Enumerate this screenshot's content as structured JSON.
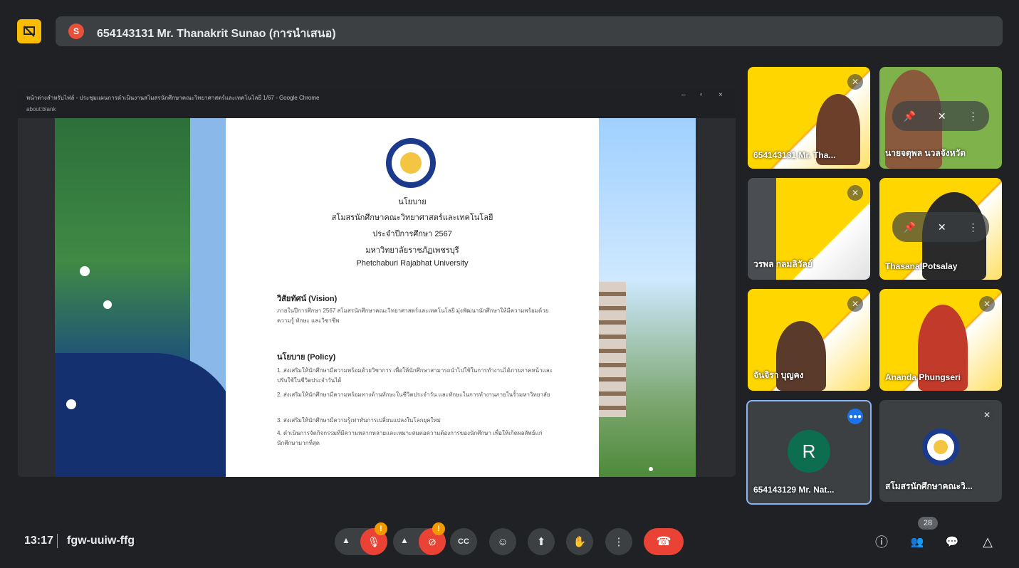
{
  "meeting": {
    "presenter_initial": "S",
    "presenter_label": "654143131 Mr. Thanakrit Sunao (การนำเสนอ)",
    "time": "13:17",
    "code": "fgw-uuiw-ffg",
    "participant_count": "28"
  },
  "shared_window": {
    "title": "หน้าต่างสำหรับไฟล์ - ประชุมแผนการดำเนินงานสโมสรนักศึกษาคณะวิทยาศาสตร์และเทคโนโลยี 1/67 - Google Chrome",
    "url": "about:blank",
    "minimize": "–",
    "restore": "▫",
    "close": "×"
  },
  "document": {
    "line1": "นโยบาย",
    "line2": "สโมสรนักศึกษาคณะวิทยาศาสตร์และเทคโนโลยี",
    "line3": "ประจำปีการศึกษา 2567",
    "line4": "มหาวิทยาลัยราชภัฏเพชรบุรี",
    "line5": "Phetchaburi Rajabhat University",
    "vision_heading": "วิสัยทัศน์ (Vision)",
    "vision_text": "ภายในปีการศึกษา 2567 สโมสรนักศึกษาคณะวิทยาศาสตร์และเทคโนโลยี มุ่งพัฒนานักศึกษาให้มีความพร้อมด้วยความรู้ ทักษะ และวิชาชีพ",
    "policy_heading": "นโยบาย (Policy)",
    "policy_1": "1. ส่งเสริมให้นักศึกษามีความพร้อมด้วยวิชาการ เพื่อให้นักศึกษาสามารถนำไปใช้ในการทำงานได้ภายภาคหน้าและปรับใช้ในชีวิตประจำวันได้",
    "policy_2": "2. ส่งเสริมให้นักศึกษามีความพร้อมทางด้านทักษะในชีวิตประจำวัน และทักษะในการทำงานภายในรั้วมหาวิทยาลัย",
    "policy_3": "3. ส่งเสริมให้นักศึกษามีความรู้เท่าทันการเปลี่ยนแปลงในโลกยุคใหม่",
    "policy_4": "4. ดำเนินการจัดกิจกรรมที่มีความหลากหลายและเหมาะสมต่อความต้องการของนักศึกษา เพื่อให้เกิดผลลัพธ์แก่นักศึกษามากที่สุด"
  },
  "participants": [
    {
      "name": "654143131 Mr. Tha...",
      "muted": true
    },
    {
      "name": "นายจตุพล นวลจังหวัด",
      "muted": true
    },
    {
      "name": "วรพล กลมลิวัลย์",
      "muted": true
    },
    {
      "name": "Thasana Potsalay",
      "muted": true
    },
    {
      "name": "จันจิรา บุญคง",
      "muted": true
    },
    {
      "name": "Ananda Phungseri",
      "muted": true
    },
    {
      "name": "654143129 Mr. Nat...",
      "initial": "R",
      "speaking": true
    },
    {
      "name": "สโมสรนักศึกษาคณะวิ...",
      "muted": true
    }
  ],
  "icons": {
    "mic_off": "🎙",
    "cam_off": "⊘",
    "captions": "CC",
    "emoji": "☺",
    "present": "⬆",
    "hand": "✋",
    "more": "⋮",
    "hangup": "☎",
    "info": "ⓘ",
    "people": "👥",
    "chat": "💬",
    "activities": "△",
    "pin": "📌",
    "muted": "✕",
    "warning": "!",
    "speaking": "●●●"
  }
}
